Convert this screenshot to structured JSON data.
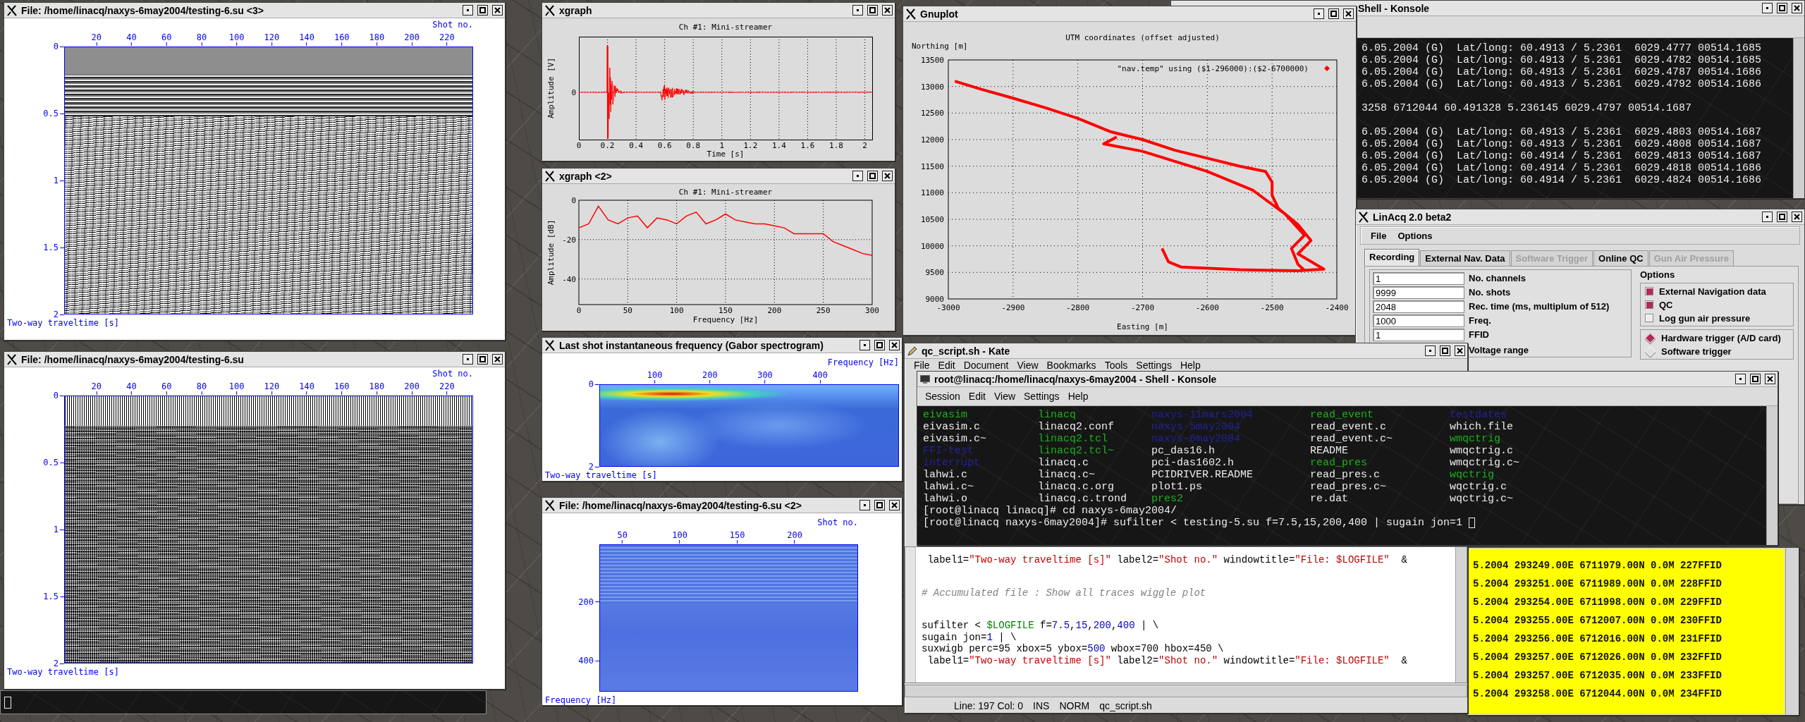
{
  "seismic_density_window": {
    "title": "File: /home/linacq/naxys-6may2004/testing-6.su <3>",
    "kind": "variable_density",
    "axis_label_top": "Shot no.",
    "x_ticks": [
      "20",
      "40",
      "60",
      "80",
      "100",
      "120",
      "140",
      "160",
      "180",
      "200",
      "220"
    ],
    "y_ticks": [
      "0",
      "0.5",
      "1",
      "1.5",
      "2"
    ],
    "axis_label_bottom": "Two-way traveltime [s]"
  },
  "seismic_wiggle_window": {
    "title": "File: /home/linacq/naxys-6may2004/testing-6.su",
    "kind": "wiggle",
    "axis_label_top": "Shot no.",
    "x_ticks": [
      "20",
      "40",
      "60",
      "80",
      "100",
      "120",
      "140",
      "160",
      "180",
      "200",
      "220"
    ],
    "y_ticks": [
      "0",
      "0.5",
      "1",
      "1.5",
      "2"
    ],
    "axis_label_bottom": "Two-way traveltime [s]"
  },
  "xgraph_time_window": {
    "title": "xgraph",
    "kind": "time",
    "subtitle": "Ch #1: Mini-streamer",
    "y_axis_label": "Amplitude [V]",
    "y_ticks": [
      "0"
    ],
    "x_ticks": [
      "0",
      "0.2",
      "0.4",
      "0.6",
      "0.8",
      "1",
      "1.2",
      "1.4",
      "1.6",
      "1.8",
      "2"
    ],
    "x_axis_label": "Time [s]"
  },
  "xgraph_spectrum_window": {
    "title": "xgraph <2>",
    "chart_data": {
      "type": "line",
      "title": "Ch #1: Mini-streamer",
      "xlabel": "Frequency [Hz]",
      "ylabel": "Amplitude [dB]",
      "x": [
        0,
        10,
        20,
        30,
        40,
        50,
        60,
        70,
        80,
        90,
        100,
        110,
        120,
        130,
        140,
        150,
        160,
        170,
        180,
        190,
        200,
        210,
        220,
        230,
        240,
        250,
        260,
        270,
        280,
        290,
        300
      ],
      "grid": true,
      "series": [
        {
          "color": "#ff0000",
          "values": [
            -14,
            -12,
            -3,
            -10,
            -12,
            -9,
            -8,
            -14,
            -9,
            -10,
            -12,
            -8,
            -6,
            -12,
            -10,
            -7,
            -10,
            -11,
            -12,
            -12,
            -13,
            -14,
            -17,
            -17,
            -17,
            -17,
            -21,
            -23,
            -25,
            -27,
            -28
          ]
        }
      ],
      "xlim": [
        0,
        300
      ],
      "ylim": [
        -53,
        0
      ],
      "xticks": [
        0,
        50,
        100,
        150,
        200,
        250,
        300
      ],
      "yticks": [
        0,
        -20,
        -40
      ]
    }
  },
  "spectrogram_window": {
    "title": "Last shot instantaneous frequency (Gabor spectrogram)",
    "kind": "spectrogram",
    "axis_label_top": "Frequency [Hz]",
    "x_ticks": [
      "100",
      "200",
      "300",
      "400"
    ],
    "y_ticks": [
      "0",
      "2"
    ],
    "axis_label_bottom": "Two-way traveltime [s]"
  },
  "spectral_section_window": {
    "title": "File: /home/linacq/naxys-6may2004/testing-6.su <2>",
    "kind": "spectral_section",
    "axis_label_top": "Shot no.",
    "x_ticks": [
      "50",
      "100",
      "150",
      "200"
    ],
    "y_ticks": [
      "200",
      "400"
    ],
    "axis_label_bottom": "Frequency [Hz]"
  },
  "gnuplot_window": {
    "title": "Gnuplot",
    "chart_data": {
      "type": "line",
      "title": "UTM coordinates (offset adjusted)",
      "xlabel": "Easting [m]",
      "ylabel": "Northing [m]",
      "grid": true,
      "x": [
        -2990,
        -2950,
        -2900,
        -2850,
        -2800,
        -2750,
        -2700,
        -2650,
        -2600,
        -2550,
        -2510,
        -2500,
        -2500,
        -2490,
        -2460,
        -2440,
        -2460,
        -2420,
        -2460,
        -2550,
        -2640,
        -2660,
        -2670,
        null,
        -2740,
        -2760,
        -2700,
        -2600,
        -2530,
        -2480,
        -2450,
        -2470,
        -2460,
        -2450
      ],
      "series": [
        {
          "name": "\"nav.temp\" using ($1-296000):($2-6700000)",
          "color": "#ff0000",
          "values": [
            13100,
            12950,
            12780,
            12600,
            12400,
            12150,
            12000,
            11800,
            11650,
            11500,
            11400,
            11200,
            10950,
            10700,
            10400,
            10100,
            9850,
            9560,
            9530,
            9550,
            9600,
            9700,
            9950,
            null,
            12050,
            11920,
            11780,
            11400,
            11050,
            10600,
            10200,
            9950,
            9650,
            9540
          ]
        }
      ],
      "xlim": [
        -3000,
        -2400
      ],
      "ylim": [
        9000,
        13500
      ],
      "xticks": [
        -3000,
        -2900,
        -2800,
        -2700,
        -2600,
        -2500,
        -2400
      ],
      "yticks": [
        9000,
        9500,
        10000,
        10500,
        11000,
        11500,
        12000,
        12500,
        13000,
        13500
      ]
    }
  },
  "navigation_konsole": {
    "title": "Shell - Konsole",
    "blocks": [
      [
        "6.05.2004 (G)  Lat/long: 60.4913 / 5.2361  6029.4777 00514.1685",
        "6.05.2004 (G)  Lat/long: 60.4913 / 5.2361  6029.4782 00514.1685",
        "6.05.2004 (G)  Lat/long: 60.4913 / 5.2361  6029.4787 00514.1686",
        "6.05.2004 (G)  Lat/long: 60.4913 / 5.2361  6029.4792 00514.1686"
      ],
      [
        "3258 6712044 60.491328 5.236145 6029.4797 00514.1687"
      ],
      [
        "6.05.2004 (G)  Lat/long: 60.4913 / 5.2361  6029.4803 00514.1687",
        "6.05.2004 (G)  Lat/long: 60.4913 / 5.2361  6029.4808 00514.1687",
        "6.05.2004 (G)  Lat/long: 60.4914 / 5.2361  6029.4813 00514.1687",
        "6.05.2004 (G)  Lat/long: 60.4914 / 5.2361  6029.4818 00514.1686",
        "6.05.2004 (G)  Lat/long: 60.4914 / 5.2361  6029.4824 00514.1686"
      ]
    ]
  },
  "linacq_window": {
    "title": "LinAcq 2.0 beta2",
    "menu": [
      "File",
      "Options"
    ],
    "tabs": [
      {
        "label": "Recording",
        "selected": true,
        "disabled": false
      },
      {
        "label": "External Nav. Data",
        "selected": false,
        "disabled": false
      },
      {
        "label": "Software Trigger",
        "selected": false,
        "disabled": true
      },
      {
        "label": "Online QC",
        "selected": false,
        "disabled": false
      },
      {
        "label": "Gun Air Pressure",
        "selected": false,
        "disabled": true
      }
    ],
    "fields": [
      {
        "value": "1",
        "label": "No. channels"
      },
      {
        "value": "9999",
        "label": "No. shots"
      },
      {
        "value": "2048",
        "label": "Rec. time (ms, multiplum of 512)"
      },
      {
        "value": "1000",
        "label": "Freq."
      },
      {
        "value": "1",
        "label": "FFID"
      }
    ],
    "extra_label": "Voltage range",
    "options_title": "Options",
    "checkboxes": [
      {
        "label": "External Navigation data",
        "checked": true
      },
      {
        "label": "QC",
        "checked": true
      },
      {
        "label": "Log gun air pressure",
        "checked": false
      }
    ],
    "radios": [
      {
        "label": "Hardware trigger (A/D card)",
        "selected": true
      },
      {
        "label": "Software trigger",
        "selected": false
      }
    ]
  },
  "ffid_log_window": {
    "lines": [
      "5.2004 293249.00E 6711979.00N 0.0M 227FFID",
      "5.2004 293251.00E 6711989.00N 0.0M 228FFID",
      "5.2004 293254.00E 6711998.00N 0.0M 229FFID",
      "5.2004 293255.00E 6712007.00N 0.0M 230FFID",
      "5.2004 293256.00E 6712016.00N 0.0M 231FFID",
      "5.2004 293257.00E 6712026.00N 0.0M 232FFID",
      "5.2004 293257.00E 6712035.00N 0.0M 233FFID",
      "5.2004 293258.00E 6712044.00N 0.0M 234FFID"
    ]
  },
  "kate_window": {
    "title": "qc_script.sh - Kate",
    "menu": [
      "File",
      "Edit",
      "Document",
      "View",
      "Bookmarks",
      "Tools",
      "Settings",
      "Help"
    ],
    "code_blocks": [
      [
        [
          {
            "kind": "plain",
            "text": " label1="
          },
          {
            "kind": "string",
            "text": "\"Two-way traveltime [s]\""
          },
          {
            "kind": "plain",
            "text": " label2="
          },
          {
            "kind": "string",
            "text": "\"Shot no.\""
          },
          {
            "kind": "plain",
            "text": " windowtitle="
          },
          {
            "kind": "string",
            "text": "\"File: $LOGFILE\""
          },
          {
            "kind": "plain",
            "text": "  &"
          }
        ]
      ],
      [
        [
          {
            "kind": "comment",
            "text": "# Accumulated file : Show all traces wiggle plot"
          }
        ]
      ],
      [
        [
          {
            "kind": "plain",
            "text": "sufilter < "
          },
          {
            "kind": "variable",
            "text": "$LOGFILE"
          },
          {
            "kind": "plain",
            "text": " f="
          },
          {
            "kind": "number",
            "text": "7.5"
          },
          {
            "kind": "plain",
            "text": ","
          },
          {
            "kind": "number",
            "text": "15"
          },
          {
            "kind": "plain",
            "text": ","
          },
          {
            "kind": "number",
            "text": "200"
          },
          {
            "kind": "plain",
            "text": ","
          },
          {
            "kind": "number",
            "text": "400"
          },
          {
            "kind": "plain",
            "text": " | \\"
          }
        ],
        [
          {
            "kind": "plain",
            "text": "sugain jon="
          },
          {
            "kind": "number",
            "text": "1"
          },
          {
            "kind": "plain",
            "text": " | \\"
          }
        ],
        [
          {
            "kind": "plain",
            "text": "suxwigb perc=95 xbox=5 ybox="
          },
          {
            "kind": "number",
            "text": "500"
          },
          {
            "kind": "plain",
            "text": " wbox=700 hbox=450 \\"
          }
        ],
        [
          {
            "kind": "plain",
            "text": " label1="
          },
          {
            "kind": "string",
            "text": "\"Two-way traveltime [s]\""
          },
          {
            "kind": "plain",
            "text": " label2="
          },
          {
            "kind": "string",
            "text": "\"Shot no.\""
          },
          {
            "kind": "plain",
            "text": " windowtitle="
          },
          {
            "kind": "string",
            "text": "\"File: $LOGFILE\""
          },
          {
            "kind": "plain",
            "text": "  &"
          }
        ]
      ]
    ],
    "status": [
      "Line: 197 Col: 0",
      "INS",
      "NORM",
      "qc_script.sh"
    ]
  },
  "shell_konsole": {
    "title": "root@linacq:/home/linacq/naxys-6may2004 - Shell - Konsole",
    "menu": [
      "Session",
      "Edit",
      "View",
      "Settings",
      "Help"
    ],
    "listing": [
      [
        {
          "text": "eivasim",
          "kind": "exec"
        },
        {
          "text": "linacq",
          "kind": "exec"
        },
        {
          "text": "naxys-11mars2004",
          "kind": "dir"
        },
        {
          "text": "read_event",
          "kind": "exec"
        },
        {
          "text": "testdates",
          "kind": "dir"
        }
      ],
      [
        {
          "text": "eivasim.c",
          "kind": "file"
        },
        {
          "text": "linacq2.conf",
          "kind": "file"
        },
        {
          "text": "naxys-5may2004",
          "kind": "dir"
        },
        {
          "text": "read_event.c",
          "kind": "file"
        },
        {
          "text": "which.file",
          "kind": "file"
        }
      ],
      [
        {
          "text": "eivasim.c~",
          "kind": "file"
        },
        {
          "text": "linacq2.tcl",
          "kind": "exec"
        },
        {
          "text": "naxys-6may2004",
          "kind": "dir"
        },
        {
          "text": "read_event.c~",
          "kind": "file"
        },
        {
          "text": "wmqctrig",
          "kind": "exec"
        }
      ],
      [
        {
          "text": "FFI-test",
          "kind": "dir"
        },
        {
          "text": "linacq2.tcl~",
          "kind": "exec"
        },
        {
          "text": "pc_das16.h",
          "kind": "file"
        },
        {
          "text": "README",
          "kind": "file"
        },
        {
          "text": "wmqctrig.c",
          "kind": "file"
        }
      ],
      [
        {
          "text": "interrupt",
          "kind": "dir"
        },
        {
          "text": "linacq.c",
          "kind": "file"
        },
        {
          "text": "pci-das1602.h",
          "kind": "file"
        },
        {
          "text": "read_pres",
          "kind": "exec"
        },
        {
          "text": "wmqctrig.c~",
          "kind": "file"
        }
      ],
      [
        {
          "text": "lahwi.c",
          "kind": "file"
        },
        {
          "text": "linacq.c~",
          "kind": "file"
        },
        {
          "text": "PCIDRIVER.README",
          "kind": "file"
        },
        {
          "text": "read_pres.c",
          "kind": "file"
        },
        {
          "text": "wqctrig",
          "kind": "exec"
        }
      ],
      [
        {
          "text": "lahwi.c~",
          "kind": "file"
        },
        {
          "text": "linacq.c.org",
          "kind": "file"
        },
        {
          "text": "plot1.ps",
          "kind": "file"
        },
        {
          "text": "read_pres.c~",
          "kind": "file"
        },
        {
          "text": "wqctrig.c",
          "kind": "file"
        }
      ],
      [
        {
          "text": "lahwi.o",
          "kind": "file"
        },
        {
          "text": "linacq.c.trond",
          "kind": "file"
        },
        {
          "text": "pres2",
          "kind": "exec"
        },
        {
          "text": "re.dat",
          "kind": "file"
        },
        {
          "text": "wqctrig.c~",
          "kind": "file"
        }
      ]
    ],
    "prompt_lines": [
      "[root@linacq linacq]# cd naxys-6may2004/",
      "[root@linacq naxys-6may2004]# sufilter < testing-5.su f=7.5,15,200,400 | sugain jon=1"
    ]
  }
}
